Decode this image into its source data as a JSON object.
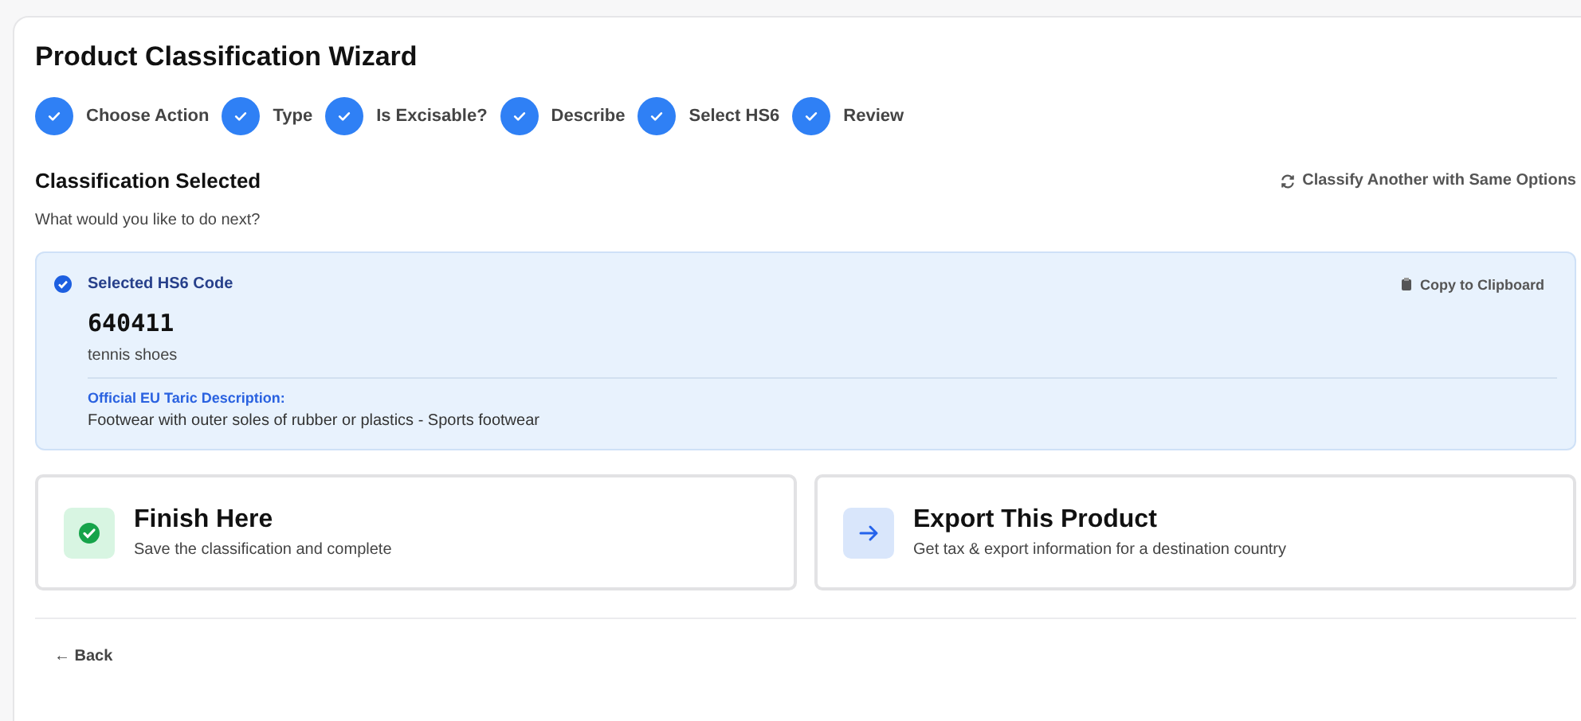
{
  "title": "Product Classification Wizard",
  "steps": [
    {
      "label": "Choose Action",
      "completed": true
    },
    {
      "label": "Type",
      "completed": true
    },
    {
      "label": "Is Excisable?",
      "completed": true
    },
    {
      "label": "Describe",
      "completed": true
    },
    {
      "label": "Select HS6",
      "completed": true
    },
    {
      "label": "Review",
      "completed": true
    }
  ],
  "section": {
    "heading": "Classification Selected",
    "subtitle": "What would you like to do next?",
    "action": "Classify Another with Same Options"
  },
  "selected_code": {
    "label": "Selected HS6 Code",
    "copy_button": "Copy to Clipboard",
    "code": "640411",
    "name": "tennis shoes",
    "taric_label": "Official EU Taric Description:",
    "taric_text": "Footwear with outer soles of rubber or plastics - Sports footwear"
  },
  "options": [
    {
      "kind": "finish",
      "title": "Finish Here",
      "description": "Save the classification and complete"
    },
    {
      "kind": "export",
      "title": "Export This Product",
      "description": "Get tax & export information for a destination country"
    }
  ],
  "back": "← Back"
}
